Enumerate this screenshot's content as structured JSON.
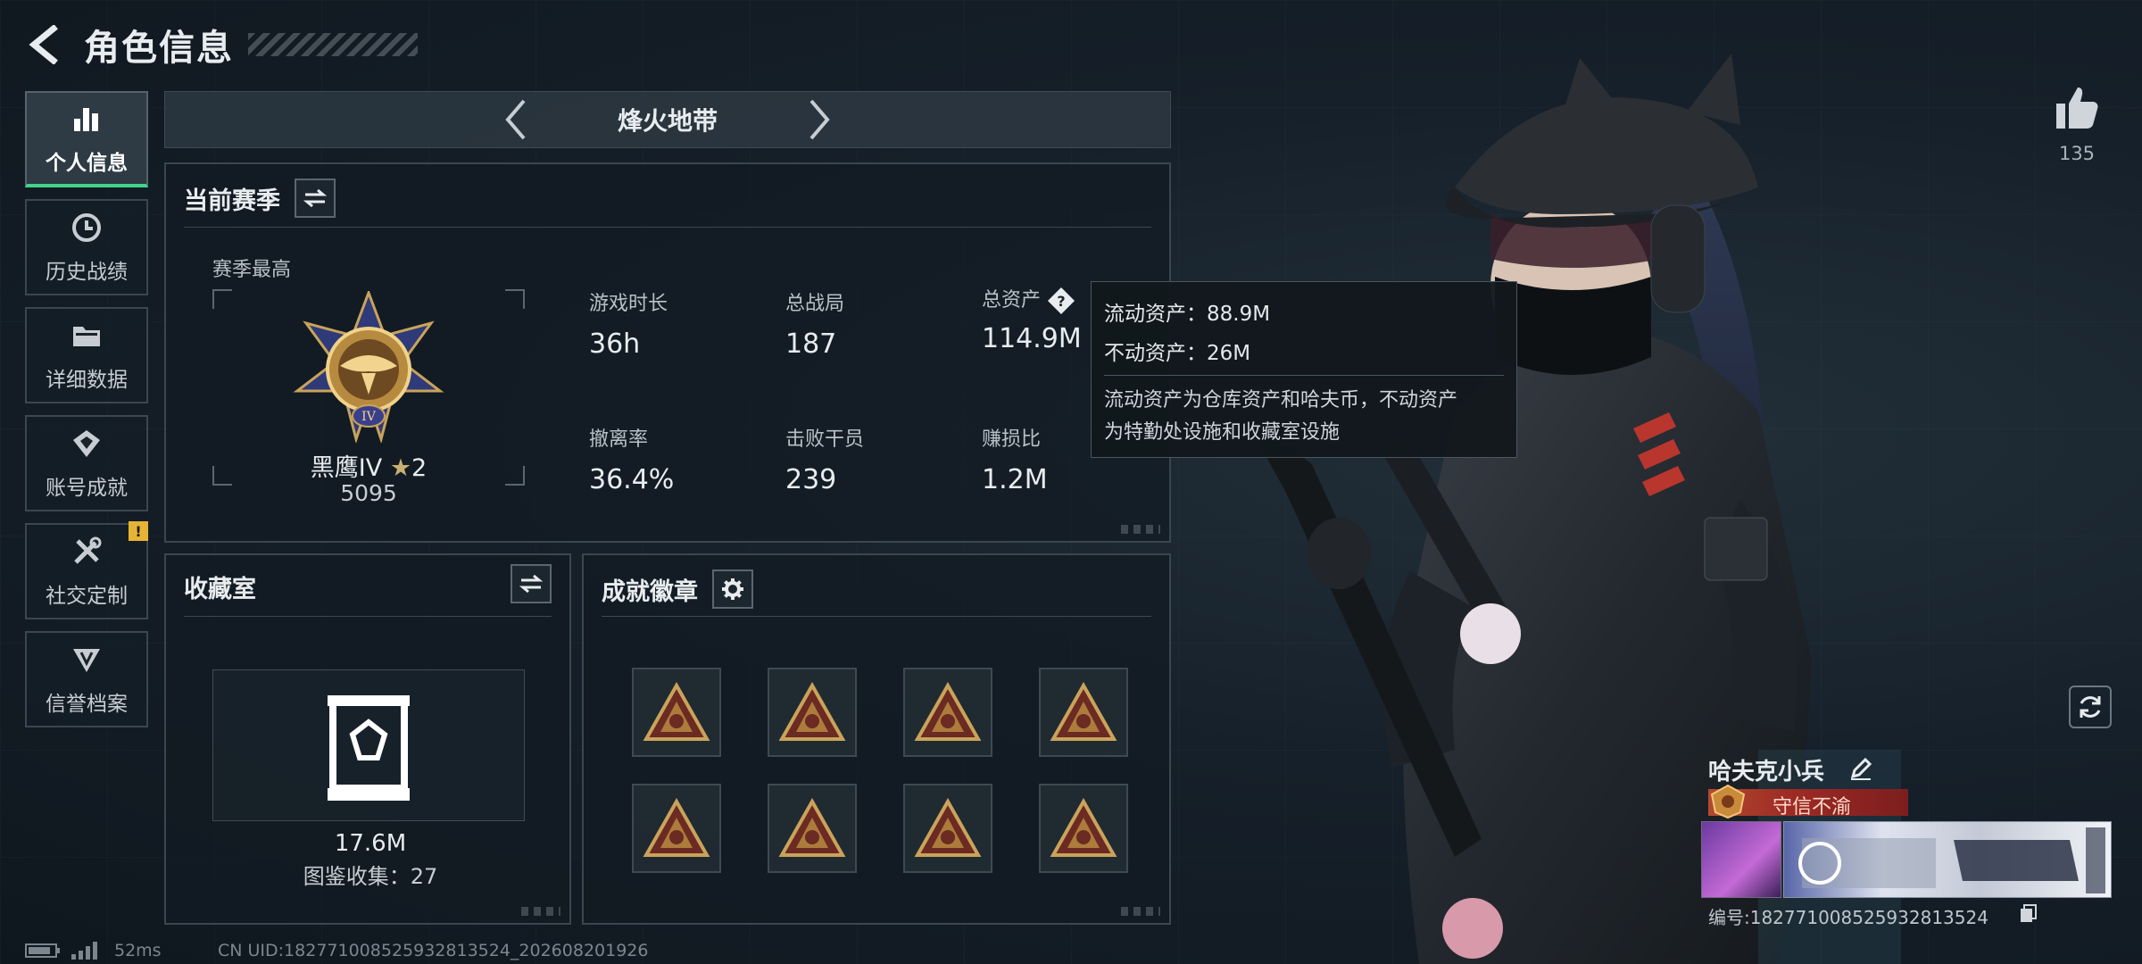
{
  "header": {
    "title": "角色信息"
  },
  "sidebar": {
    "items": [
      {
        "label": "个人信息",
        "icon": "bar-chart-icon",
        "active": true
      },
      {
        "label": "历史战绩",
        "icon": "history-clock-icon",
        "active": false
      },
      {
        "label": "详细数据",
        "icon": "folder-icon",
        "active": false
      },
      {
        "label": "账号成就",
        "icon": "achievement-badge-icon",
        "active": false
      },
      {
        "label": "社交定制",
        "icon": "tools-icon",
        "active": false,
        "alert": "!"
      },
      {
        "label": "信誉档案",
        "icon": "credit-shield-icon",
        "active": false
      }
    ]
  },
  "map_selector": {
    "name": "烽火地带"
  },
  "season_panel": {
    "title": "当前赛季",
    "best_label": "赛季最高",
    "rank_name": "黑鹰IV",
    "rank_stars": "2",
    "rank_score": "5095",
    "stats": [
      {
        "label": "游戏时长",
        "value": "36h"
      },
      {
        "label": "总战局",
        "value": "187"
      },
      {
        "label": "总资产",
        "value": "114.9M"
      },
      {
        "label": "撤离率",
        "value": "36.4%"
      },
      {
        "label": "击败干员",
        "value": "239"
      },
      {
        "label": "赚损比",
        "value": "1.2M"
      }
    ]
  },
  "tooltip": {
    "liquid": "流动资产：88.9M",
    "fixed": "不动资产：26M",
    "desc_line1": "流动资产为仓库资产和哈夫币，不动资产",
    "desc_line2": "为特勤处设施和收藏室设施"
  },
  "collection_panel": {
    "title": "收藏室",
    "value": "17.6M",
    "count": "图鉴收集：27"
  },
  "achievement_panel": {
    "title": "成就徽章",
    "badges": [
      "badge-1",
      "badge-2",
      "badge-3",
      "badge-4",
      "badge-5",
      "badge-6",
      "badge-7",
      "badge-8"
    ]
  },
  "profile": {
    "likes": "135",
    "player_name": "哈夫克小兵",
    "title_tag": "守信不渝",
    "player_id": "编号:182771008525932813524"
  },
  "status": {
    "ping": "52ms",
    "uid": "CN UID:182771008525932813524_202608201926"
  },
  "colors": {
    "accent_green": "#3fd48a",
    "alert_yellow": "#e7b334",
    "title_red": "#9e2b25"
  }
}
